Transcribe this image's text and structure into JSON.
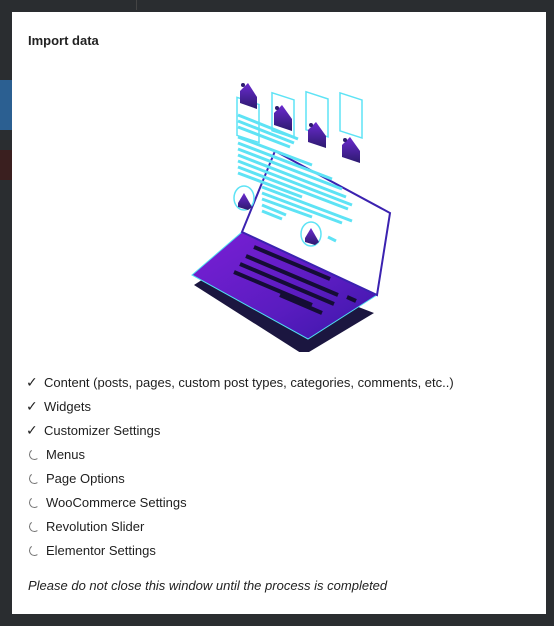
{
  "modal": {
    "title": "Import data",
    "note": "Please do not close this window until the process is completed"
  },
  "illustration": {
    "icon": "laptop-import-illustration"
  },
  "steps": [
    {
      "label": "Content (posts, pages, custom post types, categories, comments, etc..)",
      "status": "done"
    },
    {
      "label": "Widgets",
      "status": "done"
    },
    {
      "label": "Customizer Settings",
      "status": "done"
    },
    {
      "label": "Menus",
      "status": "loading"
    },
    {
      "label": "Page Options",
      "status": "loading"
    },
    {
      "label": "WooCommerce Settings",
      "status": "loading"
    },
    {
      "label": "Revolution Slider",
      "status": "loading"
    },
    {
      "label": "Elementor Settings",
      "status": "loading"
    }
  ],
  "colors": {
    "accent_purple": "#5b1fb8",
    "accent_cyan": "#5ee3f5",
    "laptop_base": "#1b1640"
  }
}
